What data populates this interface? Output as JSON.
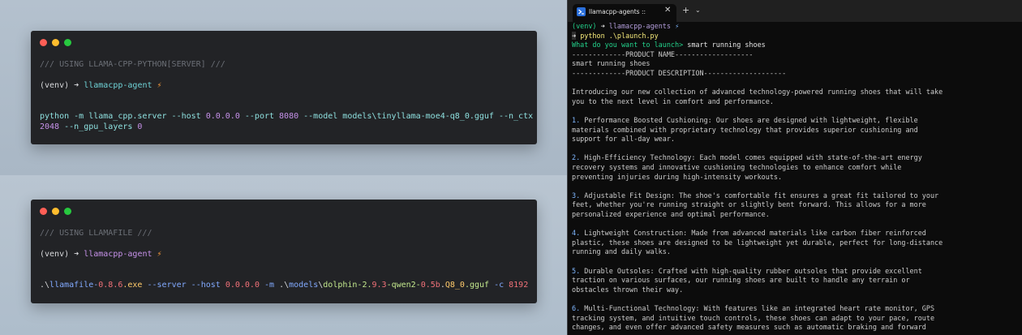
{
  "left": {
    "server_card": {
      "comment": "/// USING LLAMA-CPP-PYTHON[SERVER] ///",
      "prompt_env": "(venv)",
      "prompt_arrow": "➜",
      "prompt_dir": "llamacpp-agent",
      "bolt": "⚡",
      "cmd_part1": "python -m llama_cpp.server --host ",
      "cmd_host": "0.0.0.0",
      "cmd_part2": " --port ",
      "cmd_port": "8080",
      "cmd_part3": " --model models\\tinyllama-moe4-q8_0.gguf --n_ctx",
      "cmd_ctx": "2048",
      "cmd_part4": " --n_gpu_layers ",
      "cmd_layers": "0"
    },
    "llamafile_card": {
      "comment": "/// USING LLAMAFILE ///",
      "prompt_env": "(venv)",
      "prompt_arrow": "➜",
      "prompt_dir": "llamacpp-agent",
      "bolt": "⚡",
      "cmd_a": ".\\",
      "cmd_b": "llamafile-",
      "cmd_c": "0.8.6",
      "cmd_d": ".exe",
      "cmd_e": " --server --host ",
      "cmd_f": "0.0.0.0",
      "cmd_g": " -m ",
      "cmd_h": ".\\",
      "cmd_i": "models",
      "cmd_j": "\\",
      "cmd_k": "dolphin-2.",
      "cmd_l": "9.3",
      "cmd_m": "-qwen2-",
      "cmd_n": "0.5b",
      "cmd_o": ".",
      "cmd_p": "Q8_0",
      "cmd_q": ".gguf",
      "cmd_r": " -c ",
      "cmd_s": "8192"
    }
  },
  "terminal": {
    "tab_title": "llamacpp-agents ::",
    "tab_close": "✕",
    "new_tab": "+",
    "dropdown": "⌄",
    "prompt_env": "(venv)",
    "prompt_arrow": "➜",
    "prompt_dir": "llamacpp-agents",
    "prompt_icon": "⚡",
    "cmd_marker": "➜",
    "cmd": "python .\\plaunch.py",
    "question": "What do you want to launch>",
    "answer": " smart running shoes",
    "name_header": "-------------PRODUCT NAME-------------------",
    "name_value": "smart running shoes",
    "desc_header": "-------------PRODUCT DESCRIPTION--------------------",
    "intro_1": "Introducing our new collection of advanced technology-powered running shoes that will take",
    "intro_2": "you to the next level in comfort and performance.",
    "items": [
      {
        "num": "1.",
        "lines": [
          " Performance Boosted Cushioning: Our shoes are designed with lightweight, flexible",
          "materials combined with proprietary technology that provides superior cushioning and",
          "support for all-day wear."
        ]
      },
      {
        "num": "2.",
        "lines": [
          " High-Efficiency Technology: Each model comes equipped with state-of-the-art energy",
          "recovery systems and innovative cushioning technologies to enhance comfort while",
          "preventing injuries during high-intensity workouts."
        ]
      },
      {
        "num": "3.",
        "lines": [
          " Adjustable Fit Design: The shoe's comfortable fit ensures a great fit tailored to your",
          "feet, whether you're running straight or slightly bent forward. This allows for a more",
          "personalized experience and optimal performance."
        ]
      },
      {
        "num": "4.",
        "lines": [
          " Lightweight Construction: Made from advanced materials like carbon fiber reinforced",
          "plastic, these shoes are designed to be lightweight yet durable, perfect for long-distance",
          "running and daily walks."
        ]
      },
      {
        "num": "5.",
        "lines": [
          " Durable Outsoles: Crafted with high-quality rubber outsoles that provide excellent",
          "traction on various surfaces, our running shoes are built to handle any terrain or",
          "obstacles thrown their way."
        ]
      },
      {
        "num": "6.",
        "lines": [
          " Multi-Functional Technology: With features like an integrated heart rate monitor, GPS",
          "tracking system, and intuitive touch controls, these shoes can adapt to your pace, route",
          "changes, and even offer advanced safety measures such as automatic braking and forward"
        ]
      }
    ]
  }
}
